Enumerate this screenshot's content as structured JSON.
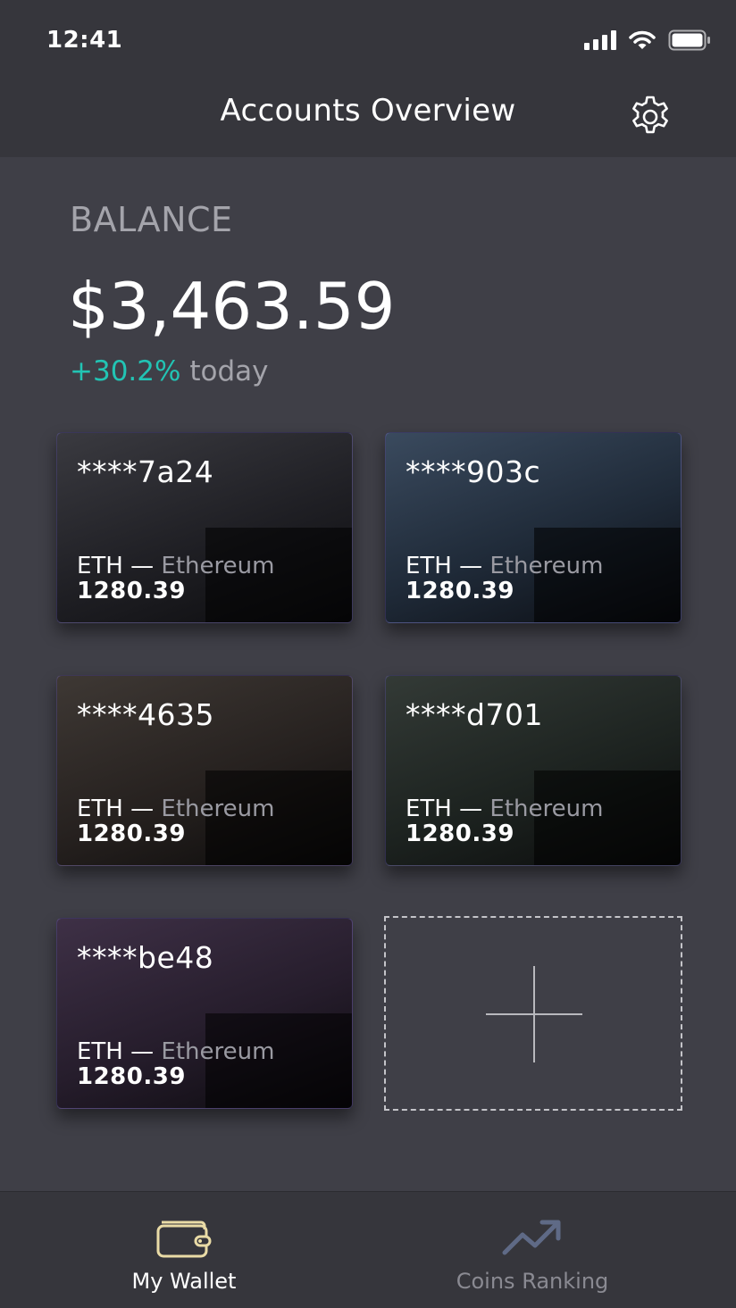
{
  "status": {
    "time": "12:41"
  },
  "header": {
    "title": "Accounts Overview",
    "settings_icon": "gear-icon"
  },
  "balance": {
    "label": "BALANCE",
    "amount": "$3,463.59",
    "change": "+30.2%",
    "change_suffix": "today",
    "change_color": "#22c4b4"
  },
  "cards": [
    {
      "id": "****7a24",
      "coin": "ETH",
      "separator": "—",
      "name": "Ethereum",
      "amount": "1280.39"
    },
    {
      "id": "****903c",
      "coin": "ETH",
      "separator": "—",
      "name": "Ethereum",
      "amount": "1280.39"
    },
    {
      "id": "****4635",
      "coin": "ETH",
      "separator": "—",
      "name": "Ethereum",
      "amount": "1280.39"
    },
    {
      "id": "****d701",
      "coin": "ETH",
      "separator": "—",
      "name": "Ethereum",
      "amount": "1280.39"
    },
    {
      "id": "****be48",
      "coin": "ETH",
      "separator": "—",
      "name": "Ethereum",
      "amount": "1280.39"
    }
  ],
  "add_card": {
    "icon": "plus-icon"
  },
  "tabs": [
    {
      "label": "My Wallet",
      "icon": "wallet-icon",
      "active": true,
      "color": "#e9dba6"
    },
    {
      "label": "Coins Ranking",
      "icon": "trending-up-icon",
      "active": false,
      "color": "#5f6a86"
    }
  ]
}
